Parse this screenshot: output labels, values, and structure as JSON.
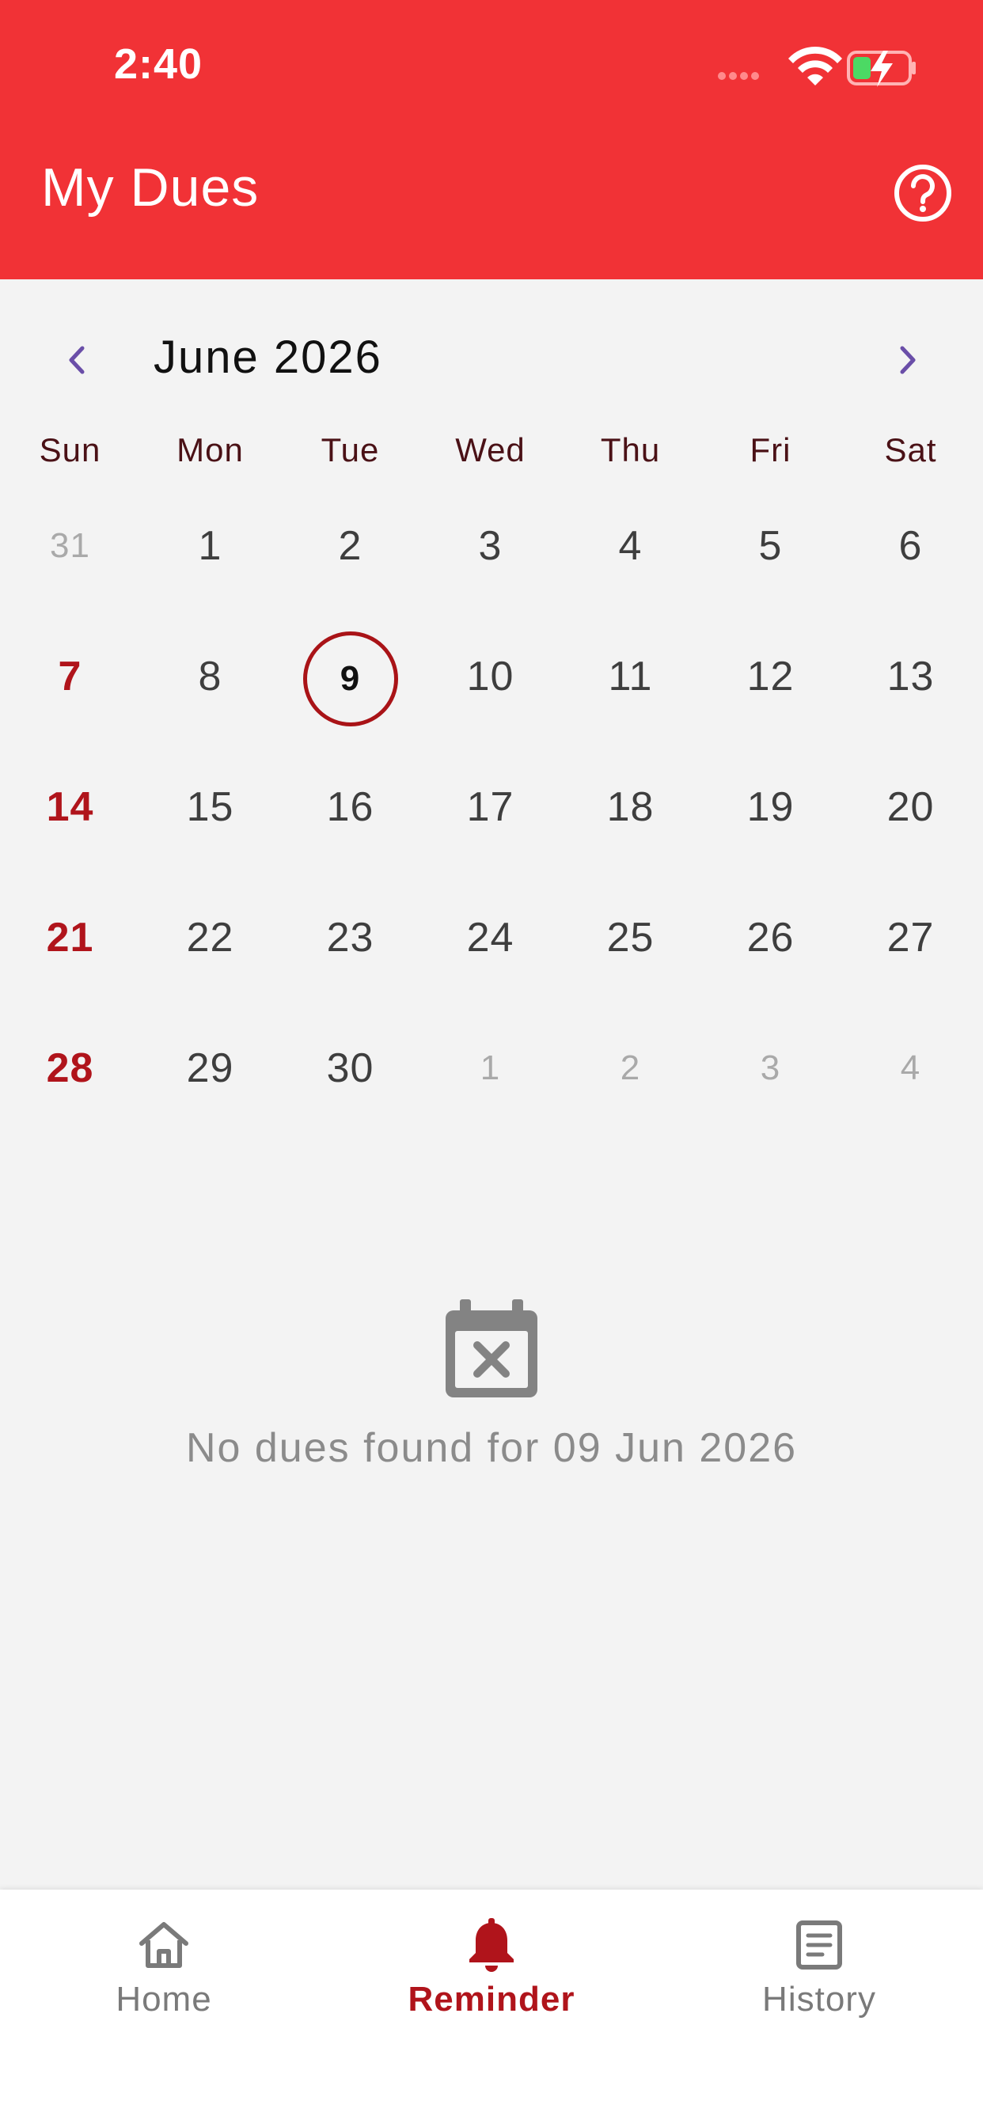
{
  "status_bar": {
    "time": "2:40"
  },
  "app_bar": {
    "title": "My Dues"
  },
  "calendar": {
    "month_label": "June 2026",
    "weekdays": [
      "Sun",
      "Mon",
      "Tue",
      "Wed",
      "Thu",
      "Fri",
      "Sat"
    ],
    "weeks": [
      [
        "31",
        "1",
        "2",
        "3",
        "4",
        "5",
        "6"
      ],
      [
        "7",
        "8",
        "9",
        "10",
        "11",
        "12",
        "13"
      ],
      [
        "14",
        "15",
        "16",
        "17",
        "18",
        "19",
        "20"
      ],
      [
        "21",
        "22",
        "23",
        "24",
        "25",
        "26",
        "27"
      ],
      [
        "28",
        "29",
        "30",
        "1",
        "2",
        "3",
        "4"
      ]
    ],
    "selected_day": "9"
  },
  "empty_state": {
    "message": "No dues found for 09 Jun 2026"
  },
  "bottom_nav": {
    "tabs": [
      {
        "label": "Home",
        "icon": "home-icon"
      },
      {
        "label": "Reminder",
        "icon": "bell-icon"
      },
      {
        "label": "History",
        "icon": "document-list-icon"
      }
    ],
    "active": "Reminder"
  },
  "colors": {
    "app_bar": "#f13236",
    "accent": "#b0141b",
    "background": "#f3f3f3",
    "nav_arrow": "#6a4ea8"
  }
}
